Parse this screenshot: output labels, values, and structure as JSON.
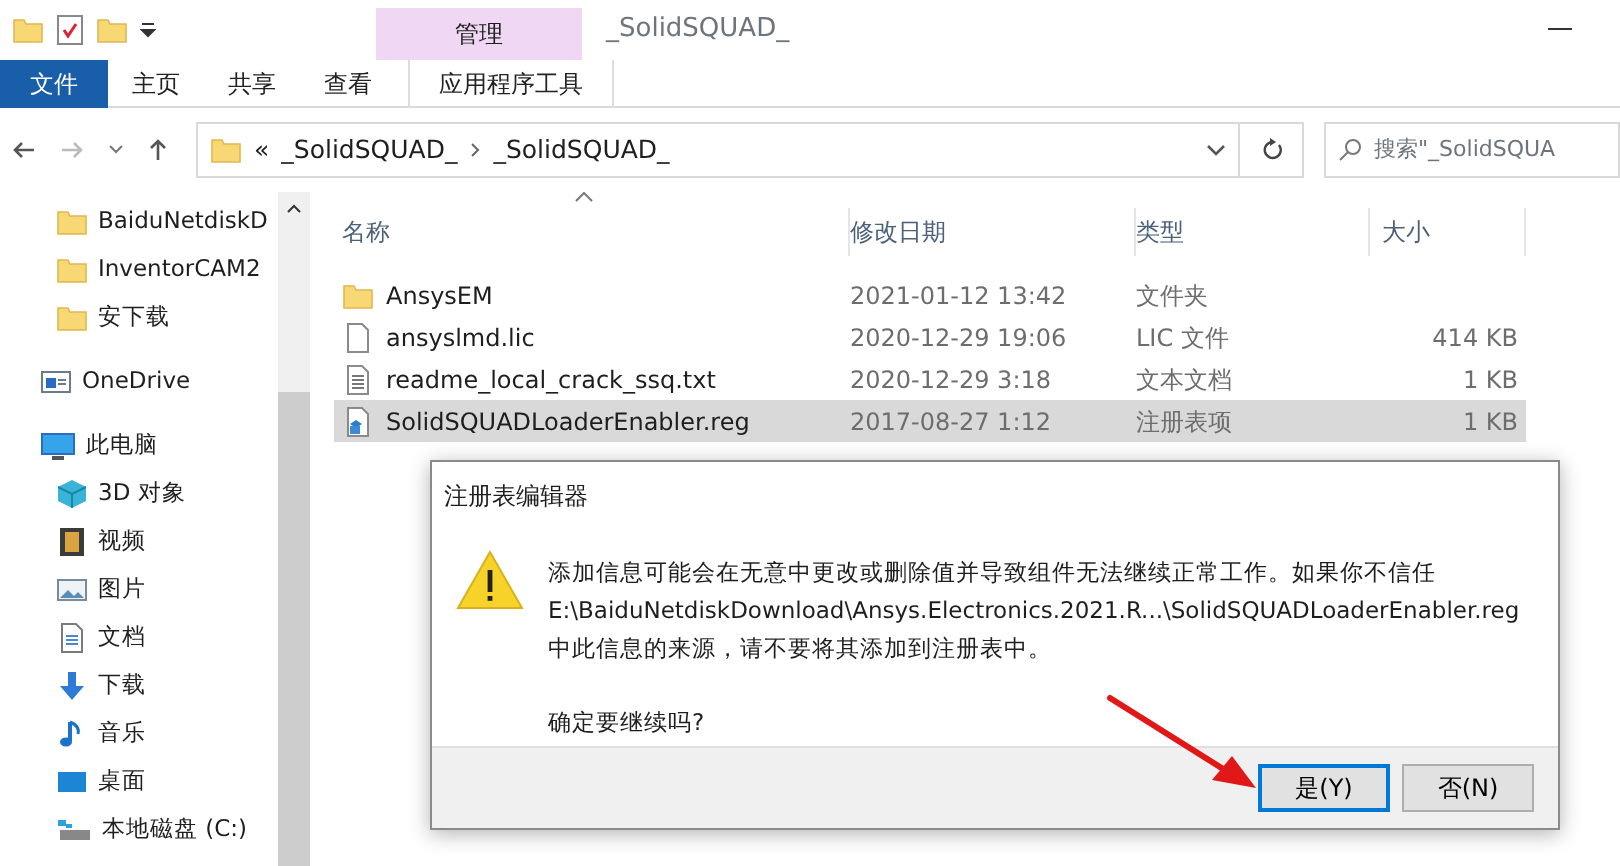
{
  "window": {
    "title": "_SolidSQUAD_"
  },
  "ribbon": {
    "context_group": "管理",
    "tabs": [
      {
        "label": "文件",
        "kind": "file"
      },
      {
        "label": "主页",
        "kind": "normal"
      },
      {
        "label": "共享",
        "kind": "normal"
      },
      {
        "label": "查看",
        "kind": "normal"
      },
      {
        "label": "应用程序工具",
        "kind": "context"
      }
    ]
  },
  "address_bar": {
    "overflow": "«",
    "segments": [
      "_SolidSQUAD_",
      "_SolidSQUAD_"
    ]
  },
  "search": {
    "placeholder": "搜索\"_SolidSQUA"
  },
  "sidebar": {
    "items": [
      {
        "label": "BaiduNetdiskD",
        "kind": "folder"
      },
      {
        "label": "InventorCAM2",
        "kind": "folder"
      },
      {
        "label": "安下载",
        "kind": "folder"
      },
      {
        "label": "OneDrive",
        "kind": "cloud"
      },
      {
        "label": "此电脑",
        "kind": "computer",
        "children": [
          {
            "label": "3D 对象",
            "kind": "cube"
          },
          {
            "label": "视频",
            "kind": "video"
          },
          {
            "label": "图片",
            "kind": "picture"
          },
          {
            "label": "文档",
            "kind": "document"
          },
          {
            "label": "下载",
            "kind": "download"
          },
          {
            "label": "音乐",
            "kind": "music"
          },
          {
            "label": "桌面",
            "kind": "desktop"
          },
          {
            "label": "本地磁盘 (C:)",
            "kind": "drive"
          }
        ]
      }
    ]
  },
  "file_list": {
    "columns": [
      "名称",
      "修改日期",
      "类型",
      "大小"
    ],
    "rows": [
      {
        "name": "AnsysEM",
        "modified": "2021-01-12 13:42",
        "type": "文件夹",
        "size": "",
        "kind": "folder",
        "selected": false
      },
      {
        "name": "ansyslmd.lic",
        "modified": "2020-12-29 19:06",
        "type": "LIC 文件",
        "size": "414 KB",
        "kind": "file",
        "selected": false
      },
      {
        "name": "readme_local_crack_ssq.txt",
        "modified": "2020-12-29 3:18",
        "type": "文本文档",
        "size": "1 KB",
        "kind": "text",
        "selected": false
      },
      {
        "name": "SolidSQUADLoaderEnabler.reg",
        "modified": "2017-08-27 1:12",
        "type": "注册表项",
        "size": "1 KB",
        "kind": "registry",
        "selected": true
      }
    ]
  },
  "dialog": {
    "title": "注册表编辑器",
    "message_lines": [
      "添加信息可能会在无意中更改或删除值并导致组件无法继续正常工作。如果你不信任",
      "E:\\BaiduNetdiskDownload\\Ansys.Electronics.2021.R...\\SolidSQUADLoaderEnabler.reg",
      "中此信息的来源，请不要将其添加到注册表中。"
    ],
    "question": "确定要继续吗?",
    "buttons": [
      {
        "label": "是(Y)",
        "default": true
      },
      {
        "label": "否(N)",
        "default": false
      }
    ]
  }
}
